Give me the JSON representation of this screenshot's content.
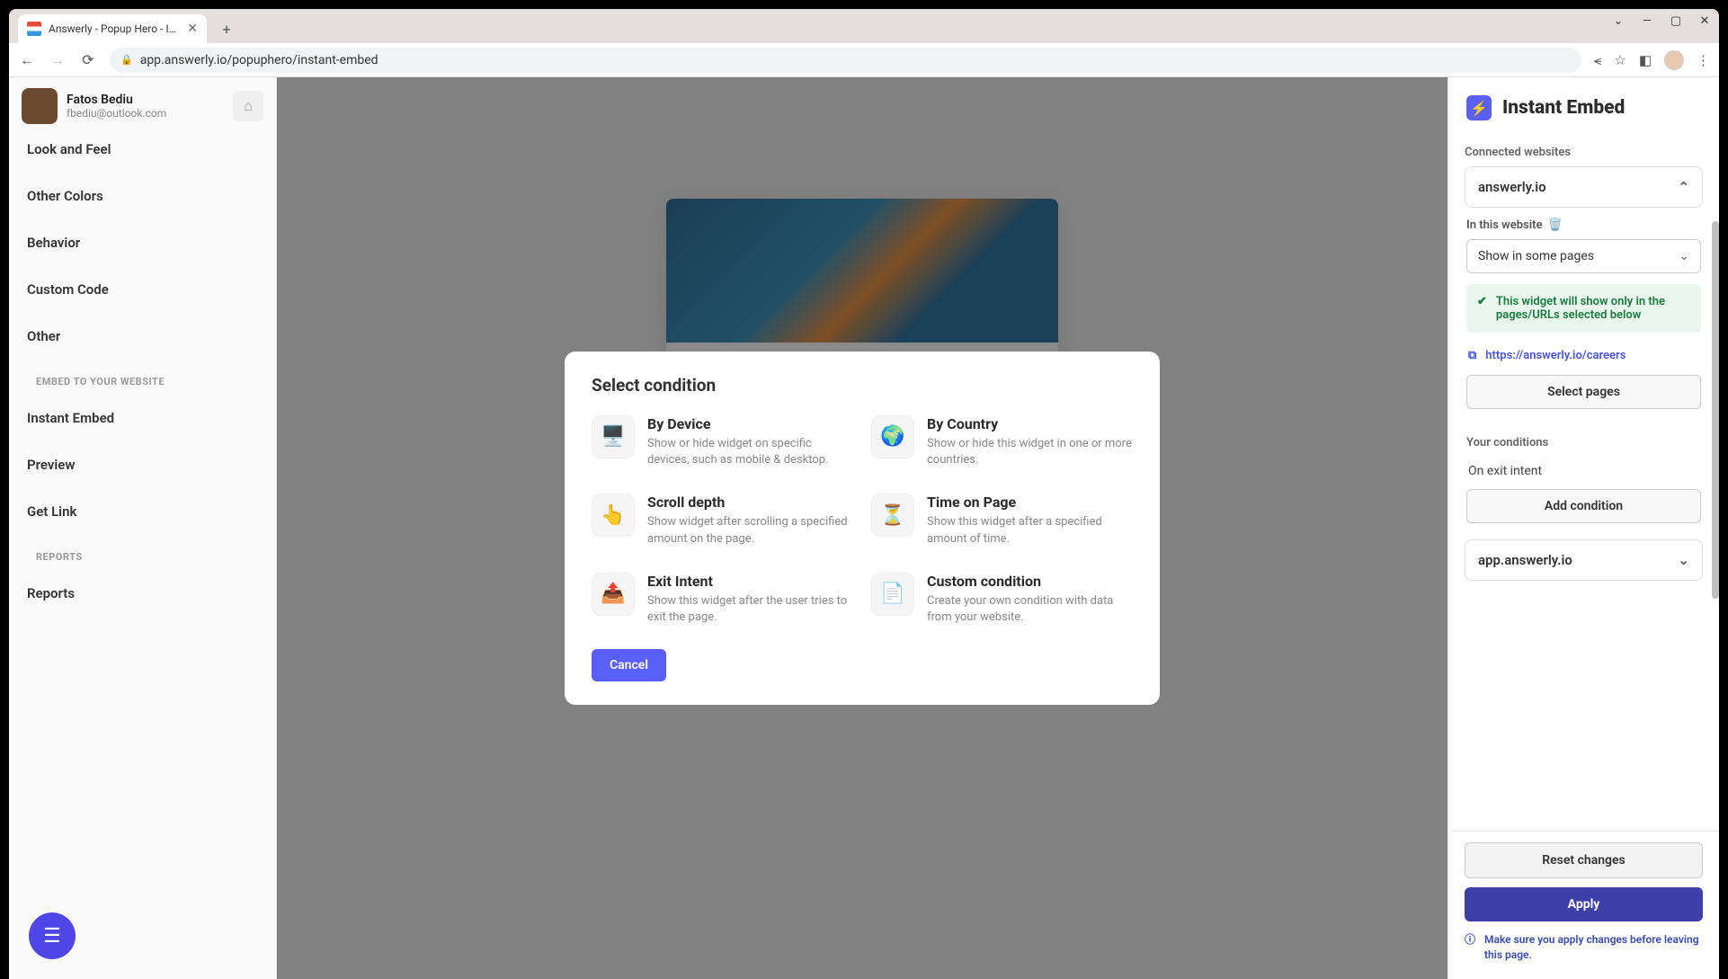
{
  "browser": {
    "tab_title": "Answerly - Popup Hero - Inst",
    "url": "app.answerly.io/popuphero/instant-embed"
  },
  "user": {
    "name": "Fatos Bediu",
    "email": "fbediu@outlook.com"
  },
  "sidebar": {
    "items_top": [
      "Look and Feel",
      "Other Colors",
      "Behavior",
      "Custom Code",
      "Other"
    ],
    "section1_header": "EMBED TO YOUR WEBSITE",
    "items_embed": [
      "Instant Embed",
      "Preview",
      "Get Link"
    ],
    "section2_header": "REPORTS",
    "items_reports": [
      "Reports"
    ]
  },
  "modal": {
    "title": "Select condition",
    "conditions": [
      {
        "icon": "🖥️",
        "title": "By Device",
        "desc": "Show or hide widget on specific devices, such as mobile & desktop."
      },
      {
        "icon": "🌍",
        "title": "By Country",
        "desc": "Show or hide this widget in one or more countries."
      },
      {
        "icon": "👆",
        "title": "Scroll depth",
        "desc": "Show widget after scrolling a specified amount on the page."
      },
      {
        "icon": "⏳",
        "title": "Time on Page",
        "desc": "Show this widget after a specified amount of time."
      },
      {
        "icon": "📤",
        "title": "Exit Intent",
        "desc": "Show this widget after the user tries to exit the page."
      },
      {
        "icon": "📄",
        "title": "Custom condition",
        "desc": "Create your own condition with data from your website."
      }
    ],
    "cancel": "Cancel"
  },
  "rpanel": {
    "title": "Instant Embed",
    "connected_label": "Connected websites",
    "site1": "answerly.io",
    "in_website_label": "In this website",
    "show_mode": "Show in some pages",
    "info_text": "This widget will show only in the pages/URLs selected below",
    "link_url": "https://answerly.io/careers",
    "select_pages": "Select pages",
    "conditions_label": "Your conditions",
    "condition1": "On exit intent",
    "add_condition": "Add condition",
    "site2": "app.answerly.io",
    "reset": "Reset changes",
    "apply": "Apply",
    "warning": "Make sure you apply changes before leaving this page."
  }
}
